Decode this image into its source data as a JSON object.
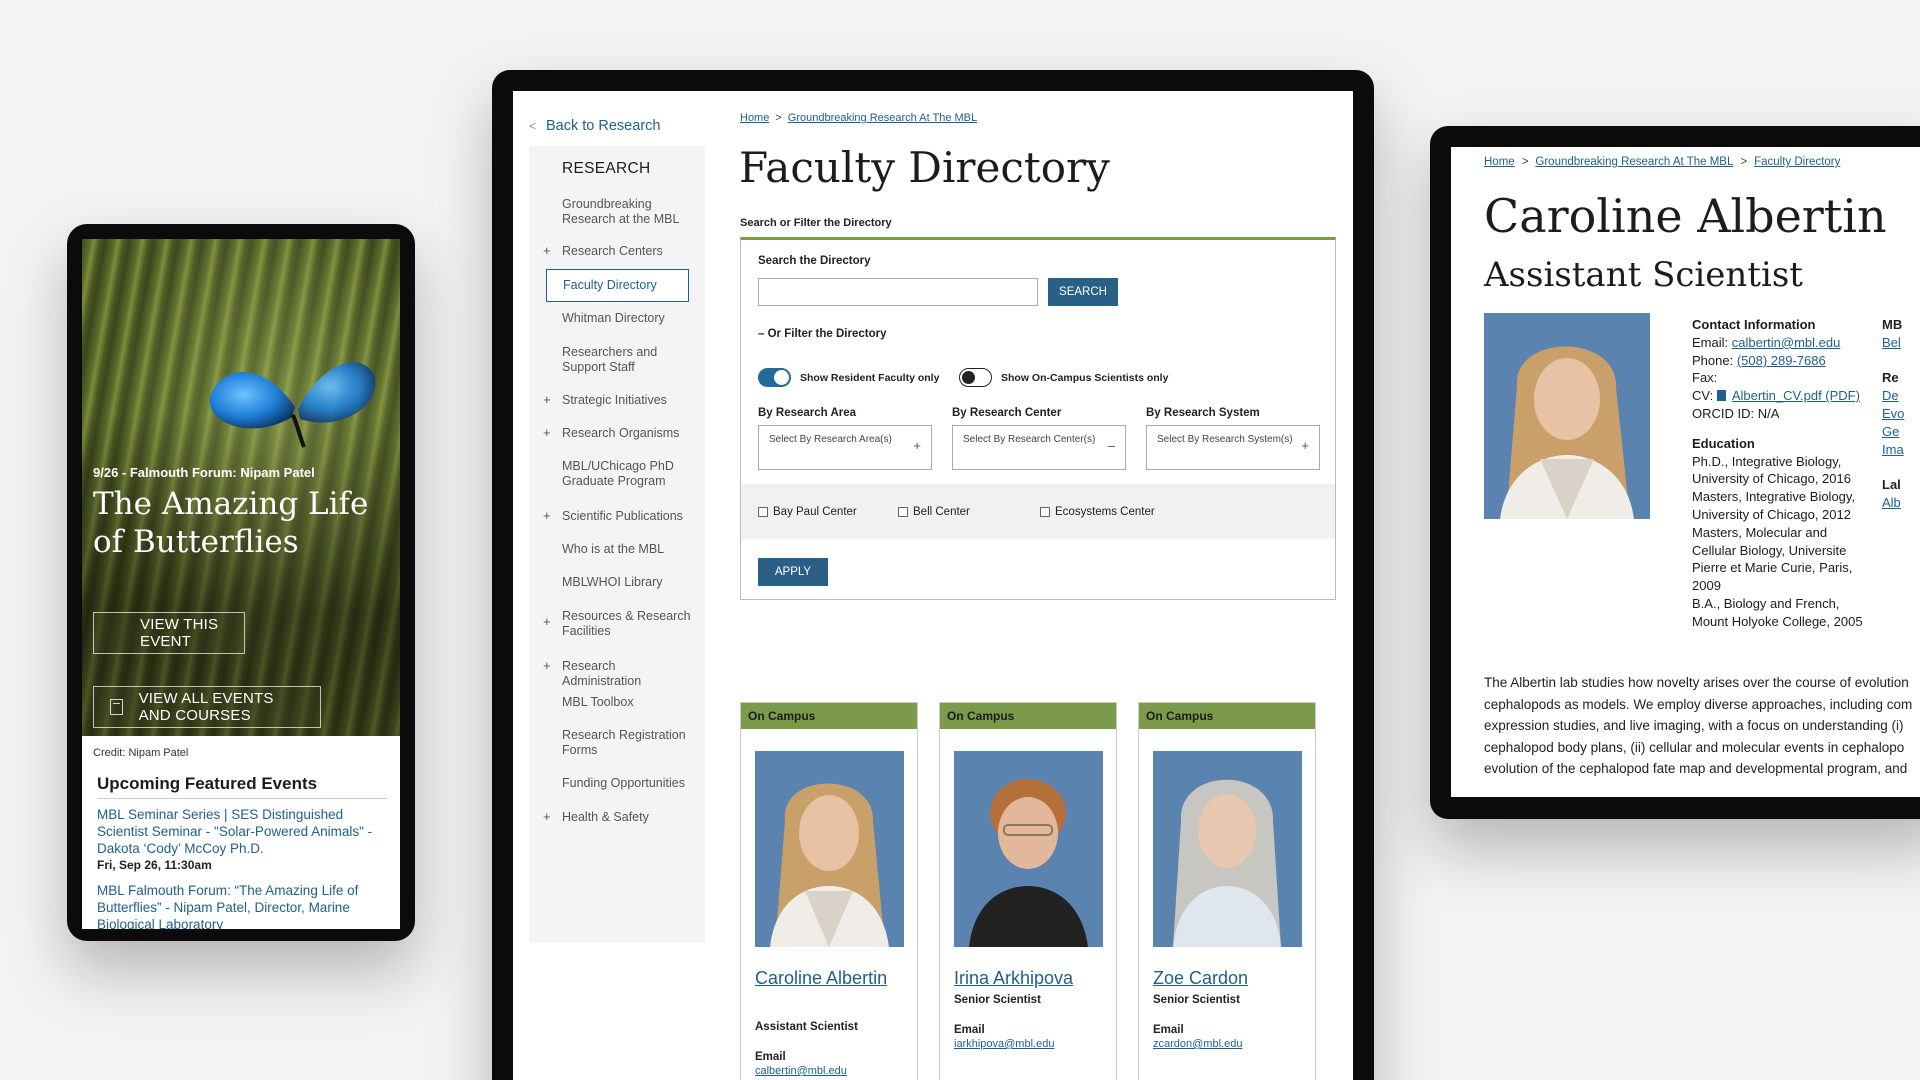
{
  "phone": {
    "hero_kicker": "9/26 - Falmouth Forum: Nipam Patel",
    "hero_title": "The Amazing Life of Butterflies",
    "view_event_label": "VIEW THIS EVENT",
    "view_all_label": "VIEW ALL EVENTS AND COURSES",
    "credit": "Credit: Nipam Patel",
    "upcoming_heading": "Upcoming Featured Events",
    "events": [
      {
        "title": "MBL Seminar Series | SES Distinguished Scientist Seminar - \"Solar-Powered Animals\" - Dakota ‘Cody’ McCoy Ph.D.",
        "date": "Fri, Sep 26, 11:30am"
      },
      {
        "title": "MBL Falmouth Forum: “The Amazing Life of Butterflies” - Nipam Patel, Director, Marine Biological Laboratory",
        "date": ""
      }
    ]
  },
  "directory": {
    "back_link": "Back to Research",
    "sidebar": {
      "heading": "RESEARCH",
      "items": [
        {
          "label": "Groundbreaking Research at the MBL",
          "plus": ""
        },
        {
          "label": "Research Centers",
          "plus": "+"
        },
        {
          "label": "Faculty Directory",
          "plus": ""
        },
        {
          "label": "Whitman Directory",
          "plus": ""
        },
        {
          "label": "Researchers and Support Staff",
          "plus": ""
        },
        {
          "label": "Strategic Initiatives",
          "plus": "+"
        },
        {
          "label": "Research Organisms",
          "plus": "+"
        },
        {
          "label": "MBL/UChicago PhD Graduate Program",
          "plus": ""
        },
        {
          "label": "Scientific Publications",
          "plus": "+"
        },
        {
          "label": "Who is at the MBL",
          "plus": ""
        },
        {
          "label": "MBLWHOI Library",
          "plus": ""
        },
        {
          "label": "Resources & Research Facilities",
          "plus": "+"
        },
        {
          "label": "Research Administration",
          "plus": "+"
        },
        {
          "label": "MBL Toolbox",
          "plus": ""
        },
        {
          "label": "Research Registration Forms",
          "plus": ""
        },
        {
          "label": "Funding Opportunities",
          "plus": ""
        },
        {
          "label": "Health & Safety",
          "plus": "+"
        }
      ]
    },
    "breadcrumbs": [
      "Home",
      "Groundbreaking Research At The MBL"
    ],
    "crumb_sep": ">",
    "title": "Faculty Directory",
    "filter_label": "Search or Filter the Directory",
    "search_label": "Search the Directory",
    "search_value": "",
    "search_button": "SEARCH",
    "or_filter": "Or Filter the Directory",
    "or_filter_sign": "–",
    "toggle_resident": "Show Resident Faculty only",
    "toggle_oncampus": "Show On-Campus Scientists only",
    "by_area_label": "By Research Area",
    "by_center_label": "By Research Center",
    "by_system_label": "By Research System",
    "select_area": "Select By Research Area(s)",
    "select_center": "Select By Research Center(s)",
    "select_system": "Select By Research System(s)",
    "select_area_sign": "+",
    "select_center_sign": "–",
    "select_system_sign": "+",
    "checkboxes": [
      "Bay Paul Center",
      "Bell Center",
      "Ecosystems Center"
    ],
    "apply_button": "APPLY",
    "cards": [
      {
        "badge": "On Campus",
        "name": "Caroline Albertin",
        "role": "Assistant Scientist",
        "email_label": "Email",
        "email": "calbertin@mbl.edu"
      },
      {
        "badge": "On Campus",
        "name": "Irina Arkhipova",
        "role": "Senior Scientist",
        "email_label": "Email",
        "email": "iarkhipova@mbl.edu"
      },
      {
        "badge": "On Campus",
        "name": "Zoe Cardon",
        "role": "Senior Scientist",
        "email_label": "Email",
        "email": "zcardon@mbl.edu"
      }
    ]
  },
  "profile": {
    "breadcrumbs": [
      "Home",
      "Groundbreaking Research At The MBL",
      "Faculty Directory"
    ],
    "crumb_sep": ">",
    "name": "Caroline Albertin",
    "title": "Assistant Scientist",
    "contact_heading": "Contact Information",
    "email_label": "Email:",
    "email": "calbertin@mbl.edu",
    "phone_label": "Phone:",
    "phone": "(508) 289-7686",
    "fax_label": "Fax:",
    "cv_label": "CV:",
    "cv_link": "Albertin_CV.pdf (PDF)",
    "orcid": "ORCID ID: N/A",
    "education_heading": "Education",
    "education": [
      "Ph.D., Integrative Biology, University of Chicago, 2016",
      "Masters, Integrative Biology, University of Chicago, 2012",
      "Masters, Molecular and Cellular Biology, Universite Pierre et Marie Curie, Paris, 2009",
      "B.A., Biology and French, Mount Holyoke College, 2005"
    ],
    "col3": [
      "MB",
      "Bel",
      "Re",
      "De",
      "Evo",
      "Ge",
      "Ima",
      "Lal",
      "Alb"
    ],
    "bio_lines": [
      "The Albertin lab studies how novelty arises over the course of evolution",
      "cephalopods as models. We employ diverse approaches, including com",
      "expression studies, and live imaging, with a focus on understanding (i)",
      "cephalopod body plans, (ii) cellular and molecular events in cephalopo",
      "evolution of the cephalopod fate map and developmental program, and"
    ]
  },
  "colors": {
    "accent": "#1f5f8b",
    "green": "#7b9a4a",
    "button": "#2a5f86"
  }
}
